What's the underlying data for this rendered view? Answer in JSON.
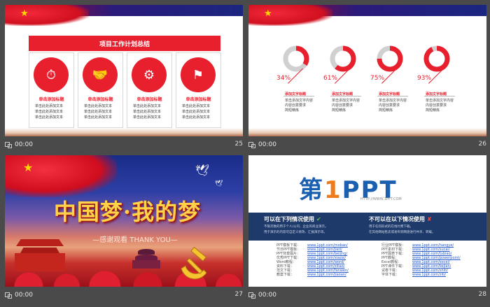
{
  "slides": [
    {
      "number": "25",
      "time": "00:00",
      "title": "项目工作计划总结",
      "cards": [
        {
          "icon": "stopwatch-icon",
          "glyph": "⏱",
          "title": "单击添加标题",
          "lines": [
            "单击此处添加文本",
            "单击此处添加文本",
            "单击此处添加文本"
          ]
        },
        {
          "icon": "handshake-icon",
          "glyph": "🤝",
          "title": "单击添加标题",
          "lines": [
            "单击此处添加文本",
            "单击此处添加文本",
            "单击此处添加文本"
          ]
        },
        {
          "icon": "monitor-gear-icon",
          "glyph": "⚙",
          "title": "单击添加标题",
          "lines": [
            "单击此处添加文本",
            "单击此处添加文本",
            "单击此处添加文本"
          ]
        },
        {
          "icon": "people-building-icon",
          "glyph": "⚑",
          "title": "单击添加标题",
          "lines": [
            "单击此处添加文本",
            "单击此处添加文本",
            "单击此处添加文本"
          ]
        }
      ]
    },
    {
      "number": "26",
      "time": "00:00",
      "donuts": [
        {
          "percent": 34,
          "label": "34%",
          "title": "添加文字标题",
          "lines": [
            "单击添加文字内容",
            "内容创意要求",
            "简短精炼"
          ]
        },
        {
          "percent": 61,
          "label": "61%",
          "title": "添加文字标题",
          "lines": [
            "单击添加文字内容",
            "内容创意要求",
            "简短精炼"
          ]
        },
        {
          "percent": 75,
          "label": "75%",
          "title": "添加文字标题",
          "lines": [
            "单击添加文字内容",
            "内容创意要求",
            "简短精炼"
          ]
        },
        {
          "percent": 93,
          "label": "93%",
          "title": "添加文字标题",
          "lines": [
            "单击添加文字内容",
            "内容创意要求",
            "简短精炼"
          ]
        }
      ]
    },
    {
      "number": "27",
      "time": "00:00",
      "title": "中国梦·我的梦",
      "subtitle": "—感谢观看 THANK YOU—"
    },
    {
      "number": "28",
      "time": "00:00",
      "logo_main": "第",
      "logo_one": "1",
      "logo_rest": "PPT",
      "logo_url": "HTTP://WWW.1PPT.COM",
      "can_use": {
        "title": "可以在下列情况使用",
        "mark": "✔",
        "lines": [
          "不限次数的用于个人/公司、企业的商业演示。",
          "用于演示的内容可自定义修改、汇报演示等。"
        ]
      },
      "cannot_use": {
        "title": "不可以在以下情况使用",
        "mark": "✘",
        "lines": [
          "用于任何形式的在线付费下载。",
          "在其他网站售卖或发布到网盘进行共享、转载。"
        ]
      },
      "links_left": [
        {
          "k": "PPT模板下载：",
          "v": "www.1ppt.com/moban/"
        },
        {
          "k": "节日PPT模板：",
          "v": "www.1ppt.com/jieri/"
        },
        {
          "k": "PPT背景图片：",
          "v": "www.1ppt.com/beijing/"
        },
        {
          "k": "优秀PPT下载：",
          "v": "www.1ppt.com/xiazai/"
        },
        {
          "k": "Word教程：",
          "v": "www.1ppt.com/word/"
        },
        {
          "k": "资料下载：",
          "v": "www.1ppt.com/ziliao/"
        },
        {
          "k": "范文下载：",
          "v": "www.1ppt.com/fanwen/"
        },
        {
          "k": "教案下载：",
          "v": "www.1ppt.com/jiaoan/"
        }
      ],
      "links_right": [
        {
          "k": "行业PPT模板：",
          "v": "www.1ppt.com/hangye/"
        },
        {
          "k": "PPT素材下载：",
          "v": "www.1ppt.com/sucai/"
        },
        {
          "k": "PPT图表下载：",
          "v": "www.1ppt.com/tubiao/"
        },
        {
          "k": "PPT教程：",
          "v": "www.1ppt.com/powerpoint/"
        },
        {
          "k": "Excel教程：",
          "v": "www.1ppt.com/excel/"
        },
        {
          "k": "PPT课件下载：",
          "v": "www.1ppt.com/kejian/"
        },
        {
          "k": "试卷下载：",
          "v": "www.1ppt.com/shiti/"
        },
        {
          "k": "字体下载：",
          "v": "www.1ppt.com/ziti/"
        }
      ]
    }
  ]
}
